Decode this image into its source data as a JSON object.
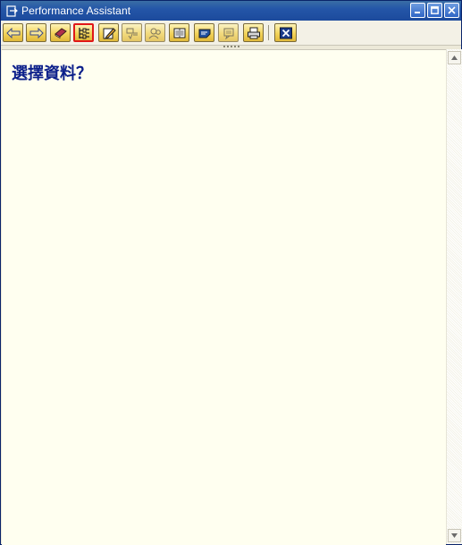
{
  "window": {
    "title": "Performance Assistant",
    "title_icon": "document-arrow-icon"
  },
  "toolbar": {
    "buttons": [
      {
        "name": "back-button",
        "icon": "arrow-left-icon"
      },
      {
        "name": "forward-button",
        "icon": "arrow-right-icon"
      },
      {
        "name": "technical-info-book-button",
        "icon": "book-icon"
      },
      {
        "name": "structure-button",
        "icon": "hierarchy-icon",
        "selected": true
      },
      {
        "name": "edit-button",
        "icon": "pencil-icon"
      },
      {
        "name": "glossary-button",
        "icon": "text-lines-icon"
      },
      {
        "name": "users-button",
        "icon": "people-icon"
      },
      {
        "name": "display-button",
        "icon": "book-open-icon"
      },
      {
        "name": "comments-button",
        "icon": "note-icon"
      },
      {
        "name": "messages-button",
        "icon": "speech-bubble-icon"
      },
      {
        "name": "print-button",
        "icon": "printer-icon"
      },
      {
        "name": "close-button",
        "icon": "close-x-icon"
      }
    ]
  },
  "content": {
    "heading": "選擇資料？"
  },
  "colors": {
    "titlebar": "#2456a8",
    "toolbar_button": "#f2d35a",
    "selected_border": "#e01818",
    "content_bg": "#fffff0",
    "heading": "#0b1f8a"
  }
}
